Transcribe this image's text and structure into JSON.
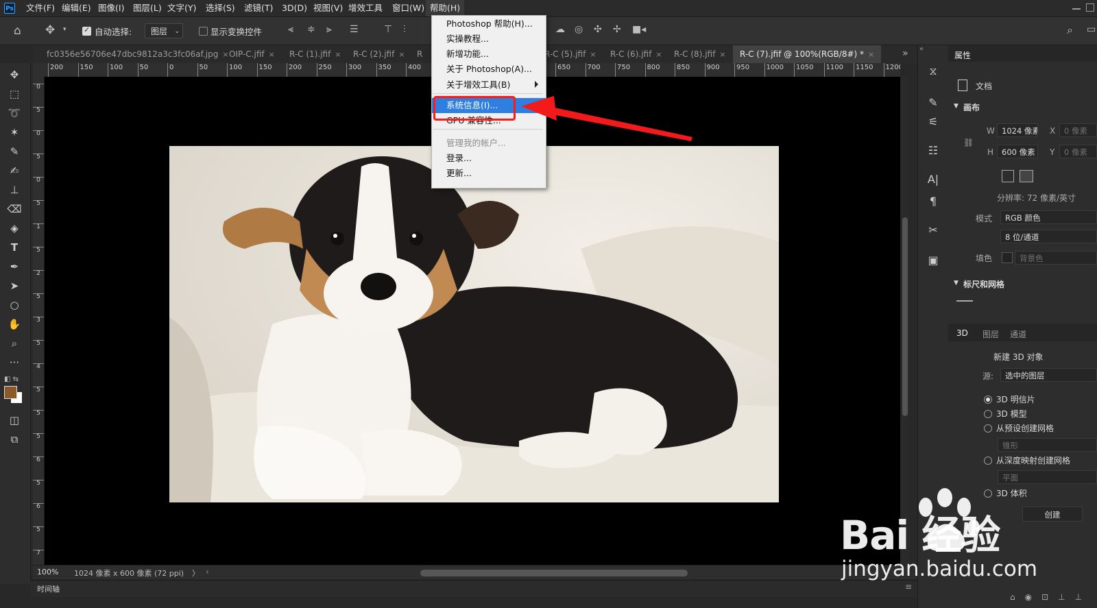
{
  "app": {
    "logo": "Ps"
  },
  "menubar": {
    "items": [
      "文件(F)",
      "编辑(E)",
      "图像(I)",
      "图层(L)",
      "文字(Y)",
      "选择(S)",
      "滤镜(T)",
      "3D(D)",
      "视图(V)",
      "增效工具",
      "窗口(W)",
      "帮助(H)"
    ],
    "active_index": 11
  },
  "options": {
    "auto_select_label": "自动选择:",
    "auto_select_checked": true,
    "auto_select_value": "图层",
    "show_transform_label": "显示变换控件",
    "show_transform_checked": false
  },
  "tabs": [
    {
      "label": "fc0356e56706e47dbc9812a3c3fc06af.jpg",
      "active": false
    },
    {
      "label": "OIP-C.jfif",
      "active": false
    },
    {
      "label": "R-C (1).jfif",
      "active": false
    },
    {
      "label": "R-C (2).jfif",
      "active": false
    },
    {
      "label": "R",
      "active": false
    },
    {
      "label": "R-C (5).jfif",
      "active": false
    },
    {
      "label": "R-C (6).jfif",
      "active": false
    },
    {
      "label": "R-C (8).jfif",
      "active": false
    },
    {
      "label": "R-C (7).jfif @ 100%(RGB/8#) *",
      "active": true
    }
  ],
  "ruler": {
    "h_labels": [
      "200",
      "150",
      "100",
      "50",
      "0",
      "50",
      "100",
      "150",
      "200",
      "250",
      "300",
      "350",
      "400",
      "650",
      "700",
      "750",
      "800",
      "850",
      "900",
      "950",
      "1000",
      "1050",
      "1100",
      "1150",
      "1200"
    ],
    "v_labels": [
      "0",
      "5",
      "0",
      "5",
      "0",
      "5",
      "1",
      "5",
      "2",
      "5",
      "3",
      "5",
      "4",
      "5",
      "5",
      "5",
      "6",
      "5",
      "6",
      "5",
      "7"
    ]
  },
  "help_menu": {
    "items": [
      {
        "label": "Photoshop 帮助(H)...",
        "state": "normal"
      },
      {
        "label": "实操教程...",
        "state": "normal"
      },
      {
        "label": "新增功能...",
        "state": "normal"
      },
      {
        "label": "关于 Photoshop(A)...",
        "state": "normal"
      },
      {
        "label": "关于增效工具(B)",
        "state": "normal",
        "submenu": true
      },
      {
        "label": "系统信息(I)...",
        "state": "highlight"
      },
      {
        "label": "GPU 兼容性...",
        "state": "normal"
      },
      {
        "label": "管理我的帐户...",
        "state": "disabled"
      },
      {
        "label": "登录...",
        "state": "normal"
      },
      {
        "label": "更新...",
        "state": "normal"
      }
    ]
  },
  "status": {
    "zoom": "100%",
    "doc_info": "1024 像素 x 600 像素 (72 ppi)",
    "arrow": "〉"
  },
  "timeline": {
    "label": "时间轴"
  },
  "properties": {
    "title": "属性",
    "doc_label": "文档",
    "canvas_section": "画布",
    "w_label": "W",
    "w_value": "1024 像素",
    "h_label": "H",
    "h_value": "600 像素",
    "x_label": "X",
    "x_value": "0 像素",
    "y_label": "Y",
    "y_value": "0 像素",
    "resolution": "分辨率: 72 像素/英寸",
    "mode_label": "模式",
    "mode_value": "RGB 颜色",
    "depth_value": "8 位/通道",
    "fill_label": "填色",
    "fill_value": "背景色",
    "ruler_grid_section": "标尺和网格"
  },
  "panel3d": {
    "tabs": [
      "3D",
      "图层",
      "通道"
    ],
    "new_object": "新建 3D 对象",
    "source_label": "源:",
    "source_value": "选中的图层",
    "options": [
      {
        "label": "3D 明信片",
        "checked": true
      },
      {
        "label": "3D 模型",
        "checked": false
      },
      {
        "label": "从预设创建网格",
        "checked": false
      },
      {
        "label": "从深度映射创建网格",
        "checked": false
      },
      {
        "label": "3D 体积",
        "checked": false
      }
    ],
    "preset_value": "锥形",
    "depth_map_value": "平面",
    "create_button": "创建"
  },
  "watermark": {
    "brand": "Bai  经验",
    "url": "jingyan.baidu.com"
  },
  "colors": {
    "accent": "#2f7fe0",
    "highlight_red": "#ff1a1a",
    "foreground_swatch": "#8b5a2b",
    "background_swatch": "#ffffff"
  }
}
